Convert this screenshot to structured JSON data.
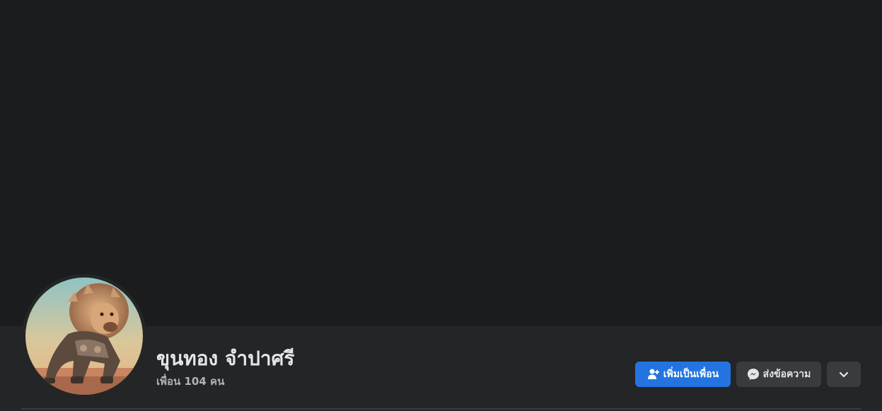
{
  "profile": {
    "name": "ขุนทอง จำปาศรี",
    "friends_count": "เพื่อน 104 คน",
    "avatar_icon": "lion-robot-avatar"
  },
  "actions": {
    "add_friend_label": "เพิ่มเป็นเพื่อน",
    "add_friend_icon": "add-friend-icon",
    "message_label": "ส่งข้อความ",
    "message_icon": "messenger-icon",
    "more_icon": "chevron-down-icon"
  },
  "colors": {
    "primary": "#2374e1",
    "background": "#18191a",
    "surface": "#242526",
    "secondary_button": "#3a3b3c"
  }
}
